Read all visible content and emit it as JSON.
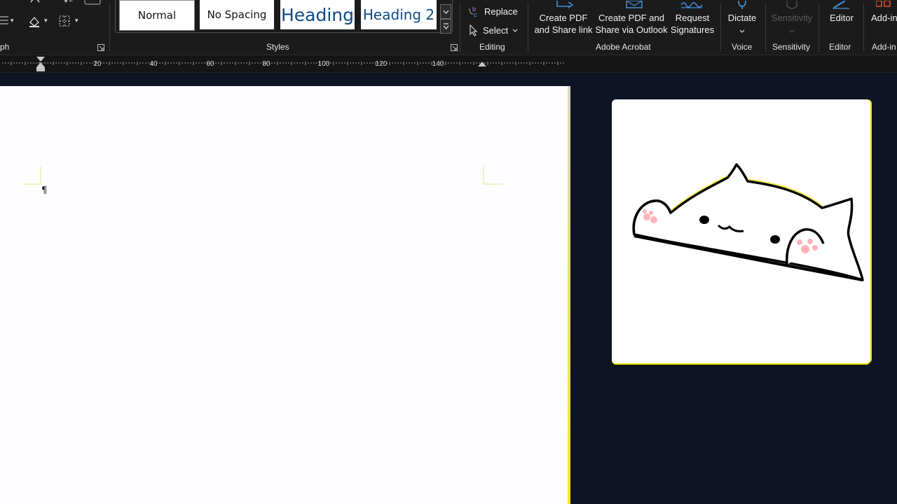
{
  "ribbon": {
    "paragraph_label": "ph",
    "styles": {
      "label": "Styles",
      "items": [
        "Normal",
        "No Spacing",
        "Heading",
        "Heading 2"
      ]
    },
    "editing": {
      "label": "Editing",
      "replace": "Replace",
      "select": "Select"
    },
    "acrobat": {
      "label": "Adobe Acrobat",
      "create_share_l1": "Create PDF",
      "create_share_l2": "and Share link",
      "create_outlook_l1": "Create PDF and",
      "create_outlook_l2": "Share via Outlook",
      "request_l1": "Request",
      "request_l2": "Signatures"
    },
    "voice": {
      "label": "Voice",
      "dictate": "Dictate"
    },
    "sensitivity": {
      "label": "Sensitivity",
      "button": "Sensitivity"
    },
    "editor": {
      "label": "Editor",
      "button": "Editor"
    },
    "addins": {
      "label": "Add-in",
      "button": "Add-in"
    }
  },
  "ruler": {
    "ticks": [
      "20",
      "40",
      "60",
      "80",
      "100",
      "120",
      "140"
    ]
  },
  "document": {
    "paragraph_mark": "¶"
  },
  "colors": {
    "ribbon_bg": "#1b1b1b",
    "workspace_bg": "#0f1424",
    "page_bg": "#fdfdff",
    "heading_blue": "#0f4a84",
    "accent_yellow": "#f4ea1a"
  },
  "icons": {
    "replace": "replace-icon",
    "select": "cursor-icon",
    "dictate": "microphone-icon"
  }
}
